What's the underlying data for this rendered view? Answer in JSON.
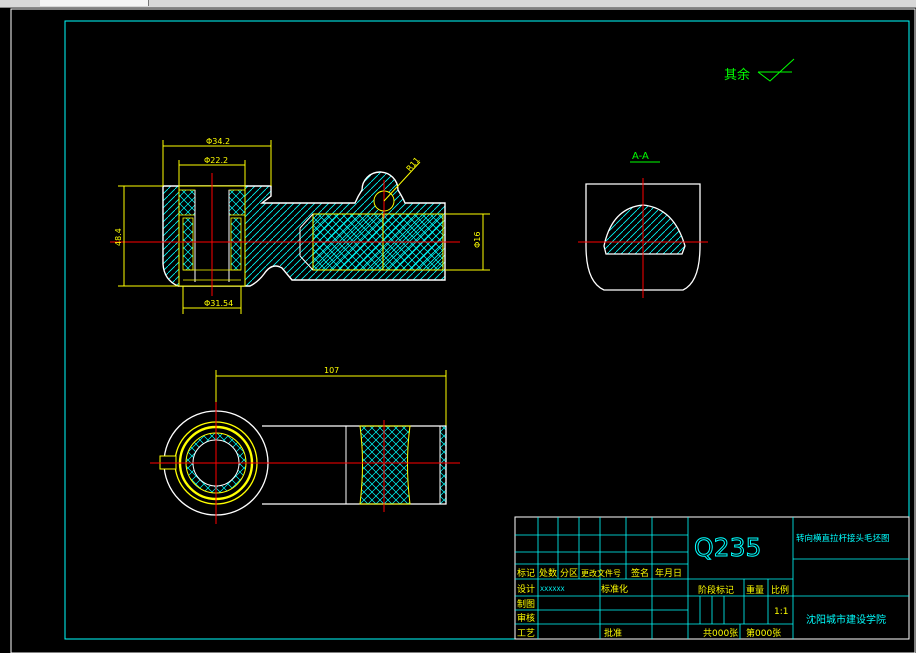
{
  "drawing": {
    "roughness_note": "其余",
    "section_label": "A-A",
    "dims": {
      "top_outer": "Φ34.2",
      "top_inner": "Φ22.2",
      "bottom_dia": "Φ31.54",
      "height": "48.4",
      "shaft_dia": "Φ16",
      "radius": "R11",
      "length": "107"
    }
  },
  "title_block": {
    "material": "Q235",
    "part_name": "转向横直拉杆接头毛坯图",
    "school": "沈阳城市建设学院",
    "scale": "1:1",
    "headers": [
      "标记",
      "处数",
      "分区",
      "更改文件号",
      "签名",
      "年月日"
    ],
    "design_label": "设计",
    "design_name": "XXXXXX",
    "standardize_label": "标准化",
    "draw_label": "制图",
    "review_label": "审核",
    "process_label": "工艺",
    "approve_label": "批准",
    "stage_label": "阶段标记",
    "weight_label": "重量",
    "ratio_label": "比例",
    "sheet_total": "共000张",
    "sheet_no": "第000张"
  }
}
